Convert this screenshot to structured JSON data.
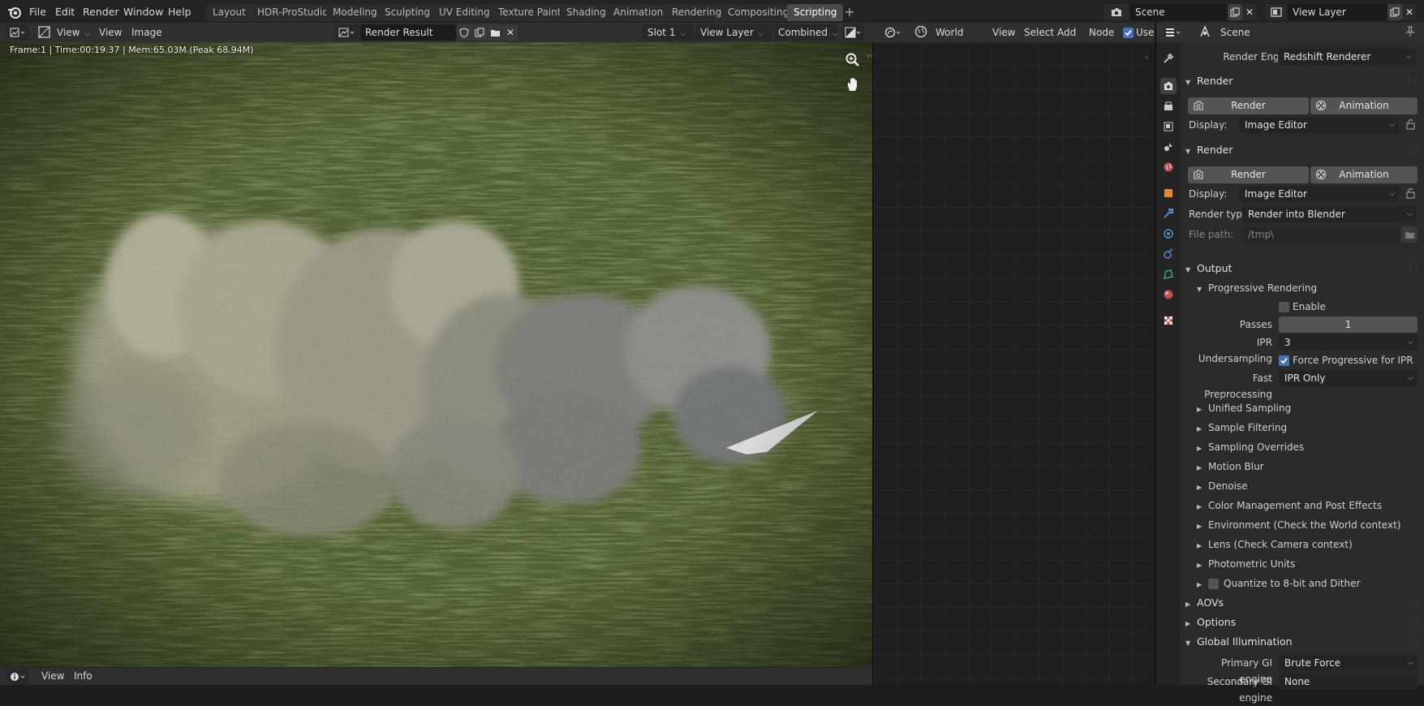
{
  "menubar": {
    "items": [
      "File",
      "Edit",
      "Render",
      "Window",
      "Help"
    ]
  },
  "workspaces": {
    "tabs": [
      "Layout",
      "HDR-ProStudio",
      "Modeling",
      "Sculpting",
      "UV Editing",
      "Texture Paint",
      "Shading",
      "Animation",
      "Rendering",
      "Compositing",
      "Scripting"
    ],
    "active": "Scripting"
  },
  "scene_selector": {
    "value": "Scene"
  },
  "viewlayer_selector": {
    "value": "View Layer"
  },
  "image_editor": {
    "menus": [
      "View",
      "View",
      "Image"
    ],
    "image_name": "Render Result",
    "slot": "Slot 1",
    "view_layer": "View Layer",
    "pass": "Combined",
    "stats": "Frame:1 | Time:00:19.37 | Mem:65.03M (Peak 68.94M)"
  },
  "node_editor": {
    "type": "World",
    "menus": [
      "View",
      "Select",
      "Add",
      "Node"
    ],
    "use_nodes_label": "Use I"
  },
  "info_bar": {
    "menus": [
      "View",
      "Info"
    ]
  },
  "properties": {
    "header": "Scene",
    "render_engine_label": "Render Engine",
    "render_engine": "Redshift Renderer",
    "panels": {
      "render1": {
        "title": "Render",
        "render_btn": "Render",
        "anim_btn": "Animation",
        "display_label": "Display:",
        "display_value": "Image Editor"
      },
      "render2": {
        "title": "Render",
        "render_btn": "Render",
        "anim_btn": "Animation",
        "display_label": "Display:",
        "display_value": "Image Editor",
        "render_type_label": "Render type:",
        "render_type_value": "Render into Blender",
        "file_path_label": "File path:",
        "file_path_value": "/tmp\\"
      },
      "output": {
        "title": "Output",
        "progressive": "Progressive Rendering",
        "enable_label": "Enable",
        "enable": false,
        "passes_label": "Passes",
        "passes": "1",
        "ipr_under_label": "IPR Undersampling",
        "ipr_under": "3",
        "force_prog_label": "Force Progressive for IPR",
        "force_prog": true,
        "fast_pre_label": "Fast Preprocessing",
        "fast_pre": "IPR Only",
        "subpanels": [
          "Unified Sampling",
          "Sample Filtering",
          "Sampling Overrides",
          "Motion Blur",
          "Denoise",
          "Color Management and Post Effects",
          "Environment (Check the World context)",
          "Lens (Check Camera context)",
          "Photometric Units"
        ],
        "quantize_label": "Quantize to 8-bit and Dither"
      },
      "aovs": {
        "title": "AOVs"
      },
      "options": {
        "title": "Options"
      },
      "gi": {
        "title": "Global Illumination",
        "primary_label": "Primary GI engine",
        "primary": "Brute Force",
        "secondary_label": "Secondary GI engine",
        "secondary": "None"
      }
    }
  },
  "colors": {
    "accent": "#4772b3",
    "panel": "#2b2b2b",
    "header": "#303030"
  }
}
